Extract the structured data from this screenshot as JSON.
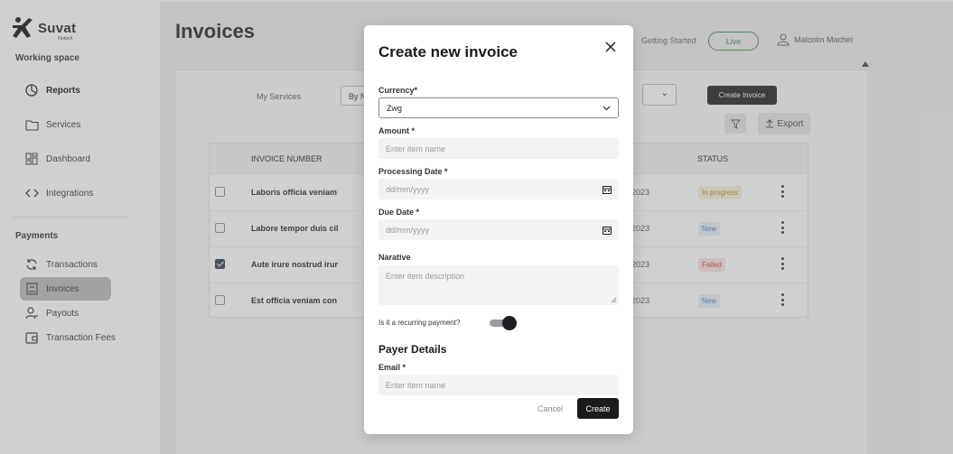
{
  "brand": {
    "logo_mark": "✕",
    "logo_text": "Suvat",
    "logo_sub": "Fintech"
  },
  "sidebar": {
    "working_space_label": "Working space",
    "working_items": [
      {
        "label": "Reports",
        "icon": "pie-chart-icon"
      },
      {
        "label": "Services",
        "icon": "folder-icon"
      },
      {
        "label": "Dashboard",
        "icon": "dashboard-icon"
      },
      {
        "label": "Integrations",
        "icon": "code-icon"
      }
    ],
    "payments_label": "Payments",
    "payment_items": [
      {
        "label": "Transactions",
        "icon": "refresh-icon"
      },
      {
        "label": "Invoices",
        "icon": "invoice-icon"
      },
      {
        "label": "Payouts",
        "icon": "user-icon"
      },
      {
        "label": "Transaction Fees",
        "icon": "wallet-icon"
      }
    ]
  },
  "header": {
    "title": "Invoices",
    "getting_started": "Getting Started",
    "live_label": "Live",
    "user_name": "Malcolm Machiri"
  },
  "toolbar": {
    "my_services_label": "My Services",
    "service_select_value": "By N",
    "create_invoice_label": "Create Invoice",
    "export_label": "Export"
  },
  "table": {
    "col_invoice_number": "INVOICE NUMBER",
    "col_status": "STATUS",
    "rows": [
      {
        "number": "Laboris officia veniam",
        "date": "2023",
        "status": "In progress",
        "checked": false
      },
      {
        "number": "Labore tempor duis cil",
        "date": "2023",
        "status": "New",
        "checked": false
      },
      {
        "number": "Aute irure nostrud irur",
        "date": "2023",
        "status": "Failed",
        "checked": true
      },
      {
        "number": "Est officia veniam con",
        "date": "2023",
        "status": "New",
        "checked": false
      }
    ]
  },
  "status_colors": {
    "in_progress_bg": "#f6efd9",
    "in_progress_fg": "#b98a2c",
    "new_bg": "#e4eef8",
    "new_fg": "#4a84c4",
    "failed_bg": "#f9e1e1",
    "failed_fg": "#d04545"
  },
  "modal": {
    "title": "Create new invoice",
    "currency_label": "Currency*",
    "currency_value": "Zwg",
    "amount_label": "Amount *",
    "amount_placeholder": "Enter item name",
    "processing_date_label": "Processing Date *",
    "processing_date_placeholder": "dd/mm/yyyy",
    "due_date_label": "Due Date *",
    "due_date_placeholder": "dd/mm/yyyy",
    "narrative_label": "Narative",
    "narrative_placeholder": "Enter item description",
    "recurring_label": "Is it a  recurring payment?",
    "recurring_on": true,
    "payer_details_title": "Payer Details",
    "email_label": "Email *",
    "email_placeholder": "Enter item name",
    "cancel_label": "Cancel",
    "create_label": "Create"
  }
}
